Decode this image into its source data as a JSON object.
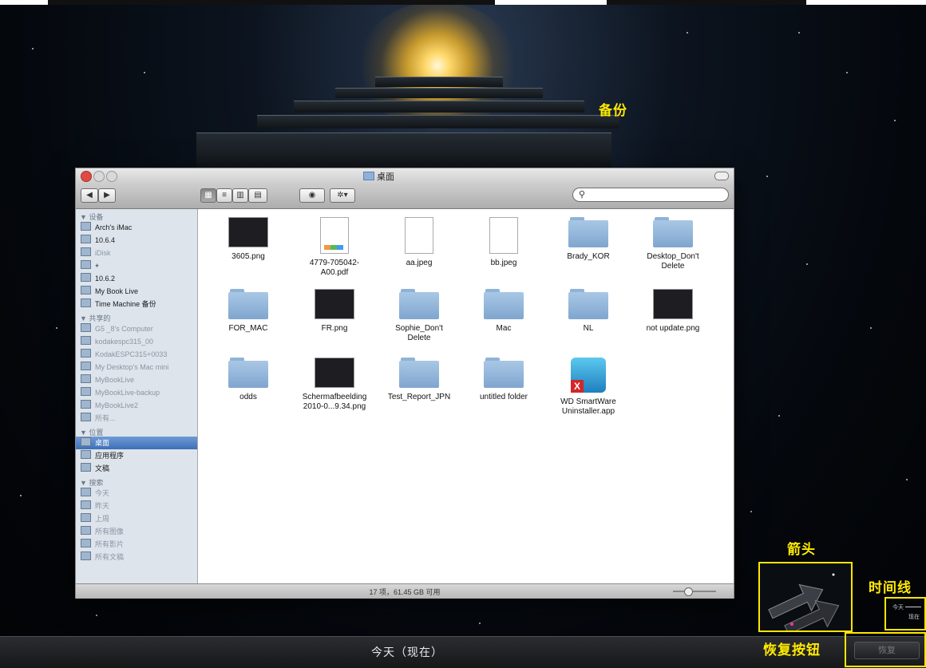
{
  "annotations": {
    "backup": "备份",
    "arrows": "箭头",
    "timeline": "时间线",
    "restore_button": "恢复按钮"
  },
  "window": {
    "title": "桌面",
    "search_placeholder": "",
    "status": "17 项，61.45 GB 可用"
  },
  "sidebar": {
    "devices_header": "▼ 设备",
    "devices": [
      "Arch's iMac",
      "10.6.4",
      "iDisk",
      "+",
      "10.6.2",
      "My Book Live",
      "Time Machine 备份"
    ],
    "shared_header": "▼ 共享的",
    "shared": [
      "G5 _8's Computer",
      "kodakespc315_00",
      "KodakESPC315+0033",
      "My Desktop's Mac mini",
      "MyBookLive",
      "MyBookLive-backup",
      "MyBookLive2",
      "所有..."
    ],
    "places_header": "▼ 位置",
    "places": [
      "桌面",
      "应用程序",
      "文稿"
    ],
    "search_header": "▼ 搜索",
    "searches": [
      "今天",
      "昨天",
      "上周",
      "所有图像",
      "所有影片",
      "所有文稿"
    ]
  },
  "files": [
    {
      "name": "3605.png",
      "kind": "screenshot"
    },
    {
      "name": "4779-705042-\nA00.pdf",
      "kind": "pdf"
    },
    {
      "name": "aa.jpeg",
      "kind": "doc"
    },
    {
      "name": "bb.jpeg",
      "kind": "doc"
    },
    {
      "name": "Brady_KOR",
      "kind": "folder"
    },
    {
      "name": "Desktop_Don't\nDelete",
      "kind": "folder"
    },
    {
      "name": "FOR_MAC",
      "kind": "folder"
    },
    {
      "name": "FR.png",
      "kind": "screenshot"
    },
    {
      "name": "Sophie_Don't\nDelete",
      "kind": "folder"
    },
    {
      "name": "Mac",
      "kind": "folder"
    },
    {
      "name": "NL",
      "kind": "folder"
    },
    {
      "name": "not update.png",
      "kind": "screenshot"
    },
    {
      "name": "odds",
      "kind": "folder"
    },
    {
      "name": "Schermafbeelding\n2010-0...9.34.png",
      "kind": "screenshot"
    },
    {
      "name": "Test_Report_JPN",
      "kind": "folder"
    },
    {
      "name": "untitled folder",
      "kind": "folder"
    },
    {
      "name": "WD SmartWare\nUninstaller.app",
      "kind": "app"
    }
  ],
  "timeline": {
    "today": "今天",
    "now": "现在"
  },
  "bottom_bar": {
    "label": "今天（现在）",
    "restore_label": "恢复"
  },
  "colors": {
    "annotation": "#ffea00",
    "selection": "#3d6fb7"
  }
}
